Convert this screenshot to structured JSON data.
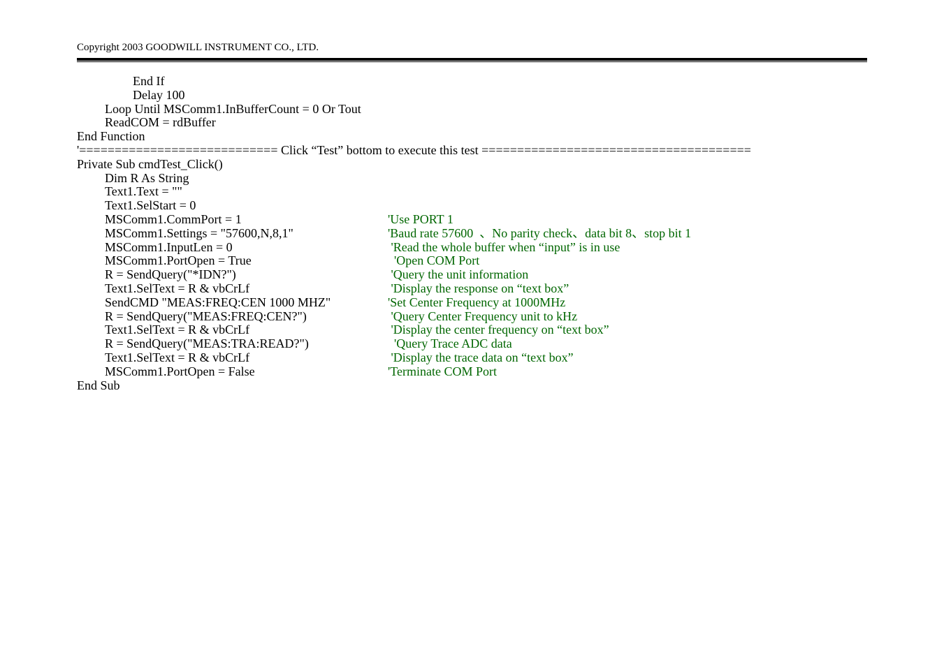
{
  "header": "Copyright 2003 GOODWILL INSTRUMENT CO., LTD.",
  "lines": [
    {
      "indent": 2,
      "code": "End If",
      "comment": ""
    },
    {
      "indent": 2,
      "code": "Delay 100",
      "comment": ""
    },
    {
      "indent": 1,
      "code": "Loop Until MSComm1.InBufferCount = 0 Or Tout",
      "comment": ""
    },
    {
      "indent": 1,
      "code": "ReadCOM = rdBuffer",
      "comment": ""
    },
    {
      "indent": 0,
      "code": "End Function",
      "comment": ""
    },
    {
      "indent": 0,
      "code": "'============================ Click “Test” bottom to execute this test ======================================",
      "comment": ""
    },
    {
      "indent": 0,
      "code": "Private Sub cmdTest_Click()",
      "comment": ""
    },
    {
      "indent": 1,
      "code": "Dim R As String",
      "comment": ""
    },
    {
      "indent": 1,
      "code": "Text1.Text = \"\"",
      "comment": ""
    },
    {
      "indent": 1,
      "code": "Text1.SelStart = 0",
      "comment": ""
    },
    {
      "indent": 1,
      "code": "MSComm1.CommPort = 1",
      "comment": "'Use PORT 1"
    },
    {
      "indent": 1,
      "code": "MSComm1.Settings = \"57600,N,8,1\"",
      "comment": "'Baud rate 57600  、No parity check、data bit 8、stop bit 1"
    },
    {
      "indent": 1,
      "code": "MSComm1.InputLen = 0",
      "comment": " 'Read the whole buffer when “input” is in use"
    },
    {
      "indent": 1,
      "code": "MSComm1.PortOpen = True",
      "comment": "  'Open COM Port"
    },
    {
      "indent": 1,
      "code": "R = SendQuery(\"*IDN?\")",
      "comment": " 'Query the unit information"
    },
    {
      "indent": 1,
      "code": "Text1.SelText = R & vbCrLf",
      "comment": " 'Display the response on “text box”"
    },
    {
      "indent": 1,
      "code": "SendCMD \"MEAS:FREQ:CEN 1000 MHZ\"",
      "comment": "'Set Center Frequency at 1000MHz"
    },
    {
      "indent": 1,
      "code": "R = SendQuery(\"MEAS:FREQ:CEN?\")",
      "comment": " 'Query Center Frequency unit to kHz"
    },
    {
      "indent": 1,
      "code": "Text1.SelText = R & vbCrLf",
      "comment": " 'Display the center frequency on “text box”"
    },
    {
      "indent": 1,
      "code": "R = SendQuery(\"MEAS:TRA:READ?\")",
      "comment": "  'Query Trace ADC data"
    },
    {
      "indent": 1,
      "code": "Text1.SelText = R & vbCrLf",
      "comment": " 'Display the trace data on “text box”"
    },
    {
      "indent": 1,
      "code": "MSComm1.PortOpen = False",
      "comment": "'Terminate COM Port"
    },
    {
      "indent": 0,
      "code": "End Sub",
      "comment": ""
    }
  ],
  "codeColWidth": 445
}
